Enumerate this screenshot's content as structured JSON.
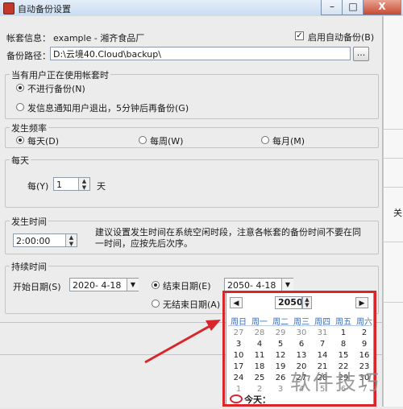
{
  "window": {
    "title": "自动备份设置",
    "icon": "app-icon",
    "min_glyph": "–",
    "max_glyph": "□",
    "close_glyph": "X"
  },
  "account": {
    "label": "帐套信息：",
    "value": "example - 湘齐食品厂",
    "auto_backup_label": "启用自动备份(B)",
    "auto_backup_checked": true,
    "checkmark": "✓"
  },
  "path": {
    "label": "备份路径：",
    "value": "D:\\云境40.Cloud\\backup\\",
    "browse_label": "..."
  },
  "in_use_group": {
    "title": "当有用户正在使用帐套时",
    "options": [
      {
        "label": "不进行备份(N)",
        "selected": true
      },
      {
        "label": "发信息通知用户退出，5分钟后再备份(G)",
        "selected": false
      }
    ]
  },
  "frequency_group": {
    "title": "发生频率",
    "options": [
      {
        "label": "每天(D)",
        "selected": true
      },
      {
        "label": "每周(W)",
        "selected": false
      },
      {
        "label": "每月(M)",
        "selected": false
      }
    ]
  },
  "daily_group": {
    "title": "每天",
    "every_label": "每(Y)",
    "every_value": "1",
    "unit": "天"
  },
  "time_group": {
    "title": "发生时间",
    "time_value": "2:00:00",
    "hint": "建议设置发生时间在系统空闲时段，注意各帐套的备份时间不要在同一时间，应按先后次序。"
  },
  "duration_group": {
    "title": "持续时间",
    "start_label": "开始日期(S)",
    "start_value": "2020- 4-18",
    "end_label": "结束日期(E)",
    "end_value": "2050- 4-18",
    "end_selected": true,
    "no_end_label": "无结束日期(A)",
    "no_end_selected": false
  },
  "calendar": {
    "prev_glyph": "◀",
    "next_glyph": "▶",
    "year": "2050",
    "weekdays": [
      "周日",
      "周一",
      "周二",
      "周三",
      "周四",
      "周五",
      "周六"
    ],
    "rows": [
      [
        "27",
        "28",
        "29",
        "30",
        "31",
        "1",
        "2"
      ],
      [
        "3",
        "4",
        "5",
        "6",
        "7",
        "8",
        "9"
      ],
      [
        "10",
        "11",
        "12",
        "13",
        "14",
        "15",
        "16"
      ],
      [
        "17",
        "18",
        "19",
        "20",
        "21",
        "22",
        "23"
      ],
      [
        "24",
        "25",
        "26",
        "27",
        "28",
        "29",
        "30"
      ],
      [
        "1",
        "2",
        "3",
        "4",
        "5",
        "6",
        "7"
      ]
    ],
    "today_label": "今天：",
    "highlight_color": "#d8262b"
  },
  "right_strip": {
    "fragment": "关"
  },
  "watermark": "软件技巧"
}
